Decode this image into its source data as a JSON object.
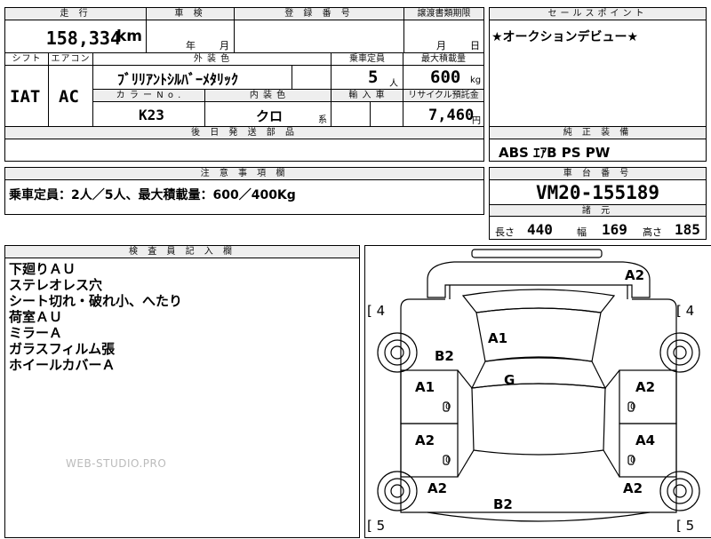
{
  "top": {
    "mileage_header": "走 行",
    "mileage_value": "158,334",
    "mileage_unit": "km",
    "inspection_header": "車 検",
    "inspection_year": "年",
    "inspection_month": "月",
    "registration_header": "登 録 番 号",
    "transfer_header": "譲渡書類期限",
    "transfer_month": "月",
    "transfer_day": "日",
    "sales_header": "セールスポイント",
    "sales_text": "★オークションデビュー★"
  },
  "row2": {
    "shift_header": "シフト",
    "shift_value": "IAT",
    "aircon_header": "エアコン",
    "aircon_value": "AC",
    "exterior_header": "外 装 色",
    "exterior_value": "ﾌﾞﾘﾘｱﾝﾄｼﾙﾊﾞｰﾒﾀﾘｯｸ",
    "capacity_header": "乗車定員",
    "capacity_value": "5",
    "capacity_unit": "人",
    "maxload_header": "最大積載量",
    "maxload_value": "600",
    "maxload_unit": "kg",
    "colorno_header": "カ ラ ー N o .",
    "colorno_value": "K23",
    "interior_header": "内 装 色",
    "interior_value": "クロ",
    "interior_suffix": "系",
    "import_header": "輸 入 車",
    "recycle_header": "リサイクル預託金",
    "recycle_value": "7,460",
    "recycle_unit": "円"
  },
  "later_parts": {
    "header": "後 日 発 送 部 品"
  },
  "equipment": {
    "header": "純 正 装 備",
    "value": "ABS ｴｱB PS PW"
  },
  "caution": {
    "header": "注 意 事 項 欄",
    "text": "乗車定員：2人／5人、最大積載量：600／400Kg"
  },
  "chassis": {
    "header": "車 台 番 号",
    "value": "VM20-155189"
  },
  "specs": {
    "header": "諸 元",
    "length_label": "長さ",
    "length_value": "440",
    "width_label": "幅",
    "width_value": "169",
    "height_label": "高さ",
    "height_value": "185"
  },
  "inspector": {
    "header": "検 査 員 記 入 欄",
    "notes": [
      "下廻りＡＵ",
      "ステレオレス穴",
      "シート切れ・破れ小、へたり",
      "荷室ＡＵ",
      "ミラーＡ",
      "ガラスフィルム張",
      "ホイールカバーＡ"
    ]
  },
  "diagram": {
    "marks": [
      "A2",
      "A1",
      "B2",
      "G",
      "A1",
      "A2",
      "A2",
      "A4",
      "A2",
      "A2",
      "B2"
    ],
    "tire_labels": [
      "[ 4",
      "[ 4",
      "[ 5",
      "[ 5"
    ],
    "zeros": [
      "0",
      "0",
      "0",
      "0"
    ]
  },
  "watermark": "WEB-STUDIO.PRO"
}
